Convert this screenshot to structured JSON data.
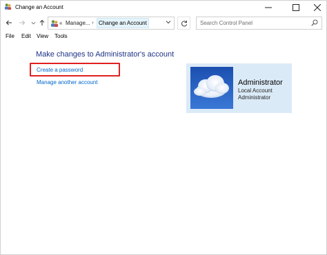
{
  "window": {
    "title": "Change an Account"
  },
  "nav": {
    "breadcrumb_overflow": "«",
    "breadcrumb": [
      "Manage...",
      "Change an Account"
    ],
    "breadcrumb_separator": "›"
  },
  "search": {
    "placeholder": "Search Control Panel"
  },
  "menu": {
    "items": [
      "File",
      "Edit",
      "View",
      "Tools"
    ]
  },
  "main": {
    "heading": "Make changes to Administrator's account",
    "links": [
      "Create a password",
      "Manage another account"
    ],
    "highlight_color": "#e02020",
    "link_color": "#0066cc",
    "heading_color": "#1e3287"
  },
  "account": {
    "name": "Administrator",
    "type": "Local Account",
    "role": "Administrator",
    "panel_color": "#dbeaf7"
  },
  "icons": {
    "app": "users-icon",
    "back": "back-arrow-icon",
    "forward": "forward-arrow-icon",
    "recent": "chevron-down-icon",
    "up": "up-arrow-icon",
    "address": "users-icon",
    "address_dropdown": "chevron-down-icon",
    "refresh": "refresh-icon",
    "search": "search-icon"
  }
}
